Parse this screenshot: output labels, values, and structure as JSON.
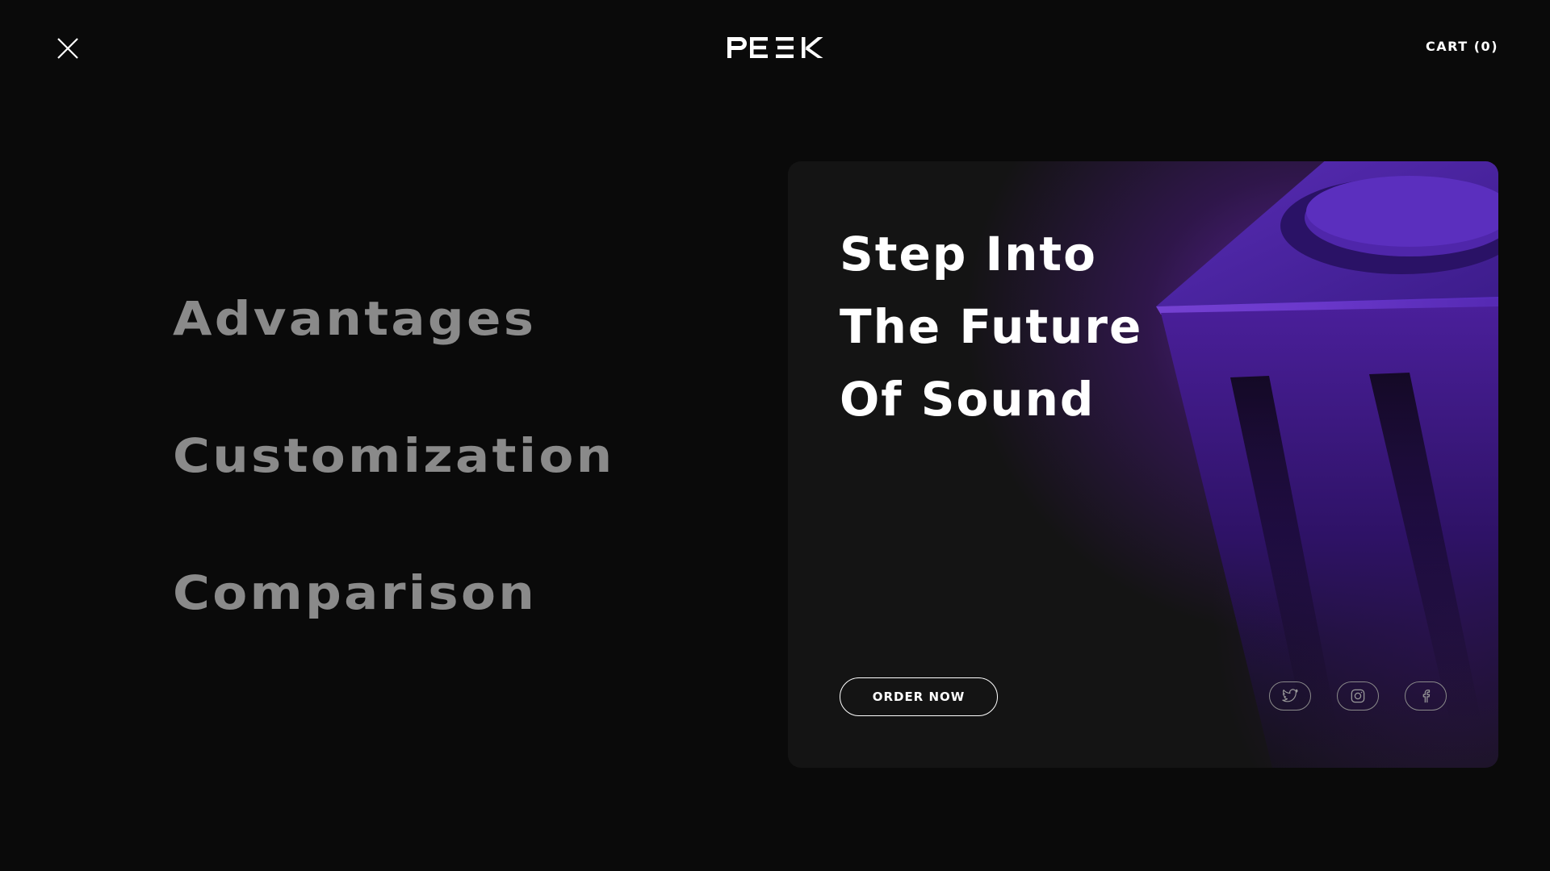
{
  "header": {
    "close_icon": "close-icon",
    "logo_text": "PEEK",
    "cart_label": "CART (0)"
  },
  "nav": {
    "items": [
      {
        "label": "Advantages"
      },
      {
        "label": "Customization"
      },
      {
        "label": "Comparison"
      }
    ]
  },
  "hero": {
    "title_lines": [
      "Step Into",
      "The Future",
      "Of Sound"
    ],
    "order_button": "ORDER NOW",
    "social_icons": [
      "twitter-icon",
      "instagram-icon",
      "facebook-icon"
    ]
  },
  "colors": {
    "background": "#0a0a0a",
    "card": "#141414",
    "accent_purple": "#6a2bc0",
    "nav_text": "#8a8a8a",
    "text": "#ffffff"
  }
}
